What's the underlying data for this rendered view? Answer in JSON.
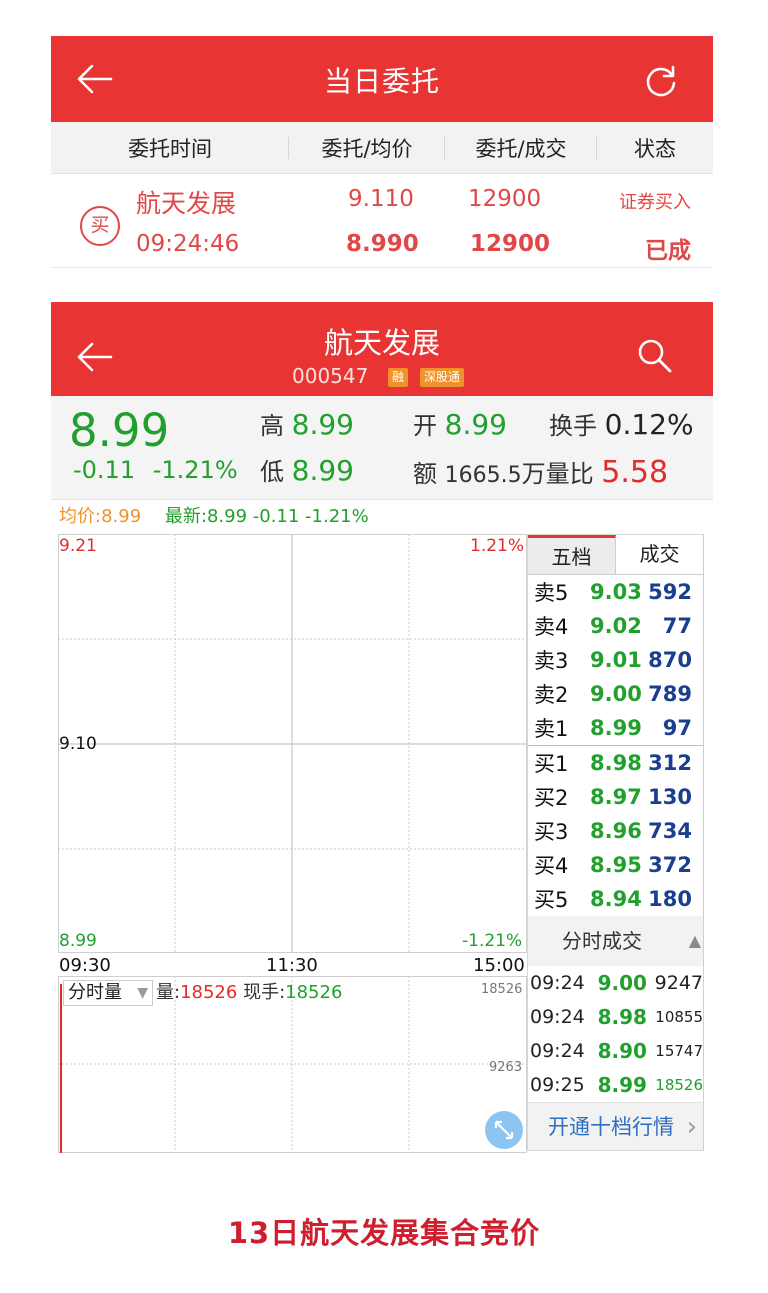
{
  "orders_screen": {
    "title": "当日委托",
    "columns": [
      "委托时间",
      "委托/均价",
      "委托/成交",
      "状态"
    ],
    "order": {
      "side_badge": "买",
      "stock_name": "航天发展",
      "time": "09:24:46",
      "order_price": "9.110",
      "avg_price": "8.990",
      "order_qty": "12900",
      "filled_qty": "12900",
      "type": "证券买入",
      "status": "已成"
    }
  },
  "quote_screen": {
    "stock_name": "航天发展",
    "stock_code": "000547",
    "tags": [
      "融",
      "深股通"
    ],
    "price": "8.99",
    "change": "-0.11",
    "change_pct": "-1.21%",
    "high_label": "高",
    "high": "8.99",
    "low_label": "低",
    "low": "8.99",
    "open_label": "开",
    "open": "8.99",
    "turnover_label": "换手",
    "turnover": "0.12%",
    "amount_label": "额",
    "amount": "1665.5",
    "amount_unit": "万",
    "volratio_label": "量比",
    "volratio": "5.58",
    "avg_label": "均价:8.99",
    "latest_label": "最新:8.99 -0.11 -1.21%",
    "chart": {
      "y_top": "9.21",
      "y_mid": "9.10",
      "y_bot": "8.99",
      "pct_top": "1.21%",
      "pct_bot": "-1.21%",
      "x_labels": [
        "09:30",
        "11:30",
        "15:00"
      ],
      "vol_select": "分时量",
      "vol_label": "量:",
      "vol_value": "18526",
      "cur_label": "现手:",
      "cur_value": "18526",
      "vol_axis_top": "18526",
      "vol_axis_mid": "9263"
    },
    "book_tabs": [
      "五档",
      "成交"
    ],
    "asks": [
      {
        "name": "卖5",
        "price": "9.03",
        "vol": "592"
      },
      {
        "name": "卖4",
        "price": "9.02",
        "vol": "77"
      },
      {
        "name": "卖3",
        "price": "9.01",
        "vol": "870"
      },
      {
        "name": "卖2",
        "price": "9.00",
        "vol": "789"
      },
      {
        "name": "卖1",
        "price": "8.99",
        "vol": "97"
      }
    ],
    "bids": [
      {
        "name": "买1",
        "price": "8.98",
        "vol": "312"
      },
      {
        "name": "买2",
        "price": "8.97",
        "vol": "130"
      },
      {
        "name": "买3",
        "price": "8.96",
        "vol": "734"
      },
      {
        "name": "买4",
        "price": "8.95",
        "vol": "372"
      },
      {
        "name": "买5",
        "price": "8.94",
        "vol": "180"
      }
    ],
    "ticks_header": "分时成交",
    "ticks": [
      {
        "time": "09:24",
        "price": "9.00",
        "vol": "9247"
      },
      {
        "time": "09:24",
        "price": "8.98",
        "vol": "10855"
      },
      {
        "time": "09:24",
        "price": "8.90",
        "vol": "15747"
      },
      {
        "time": "09:25",
        "price": "8.99",
        "vol": "18526"
      }
    ],
    "open_level10": "开通十档行情"
  },
  "caption": "13日航天发展集合竞价",
  "colors": {
    "header_red": "#e93434",
    "up_red": "#e02c2c",
    "down_green": "#21a02d",
    "vol_blue": "#1a3f8f",
    "avg_orange": "#f0922b"
  }
}
